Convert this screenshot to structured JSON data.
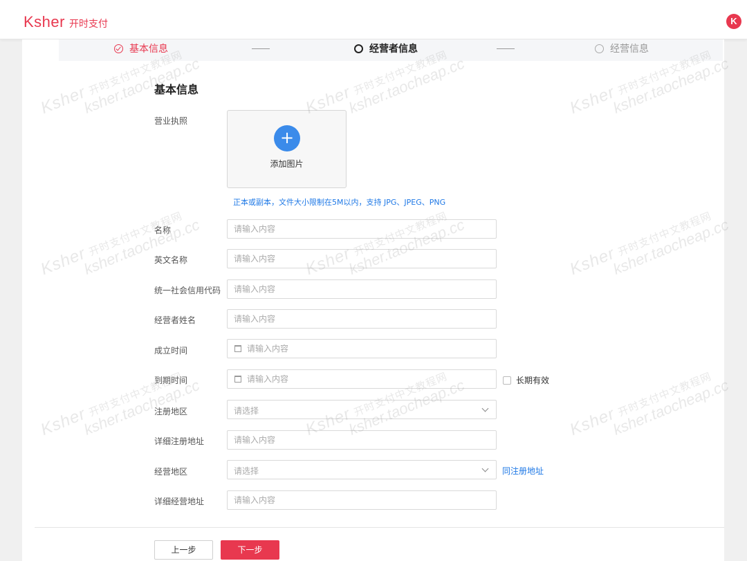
{
  "header": {
    "logo_word": "Ksher",
    "logo_cn": "开时支付",
    "avatar_letter": "K",
    "brand_color": "#e8384f"
  },
  "steps": [
    {
      "label": "基本信息",
      "state": "done"
    },
    {
      "label": "经营者信息",
      "state": "current"
    },
    {
      "label": "经营信息",
      "state": "pending"
    }
  ],
  "steps_separator": "——",
  "form": {
    "section_title": "基本信息",
    "license": {
      "label": "营业执照",
      "upload_icon": "plus-icon",
      "upload_text": "添加图片",
      "hint": "正本或副本，文件大小限制在5M以内，支持 JPG、JPEG、PNG"
    },
    "fields": {
      "name": {
        "label": "名称",
        "placeholder": "请输入内容"
      },
      "english_name": {
        "label": "英文名称",
        "placeholder": "请输入内容"
      },
      "credit_code": {
        "label": "统一社会信用代码",
        "placeholder": "请输入内容"
      },
      "operator_name": {
        "label": "经营者姓名",
        "placeholder": "请输入内容"
      },
      "established": {
        "label": "成立时间",
        "placeholder": "请输入内容"
      },
      "expiry": {
        "label": "到期时间",
        "placeholder": "请输入内容",
        "long_term_label": "长期有效"
      },
      "reg_region": {
        "label": "注册地区",
        "placeholder": "请选择"
      },
      "reg_address": {
        "label": "详细注册地址",
        "placeholder": "请输入内容"
      },
      "biz_region": {
        "label": "经营地区",
        "placeholder": "请选择",
        "same_link": "同注册地址"
      },
      "biz_address": {
        "label": "详细经营地址",
        "placeholder": "请输入内容"
      }
    }
  },
  "footer": {
    "prev_label": "上一步",
    "next_label": "下一步"
  },
  "watermark": {
    "line1": "Ksher",
    "line1_cn": "开时支付中文教程网",
    "line2": "ksher.taocheap.cc"
  }
}
